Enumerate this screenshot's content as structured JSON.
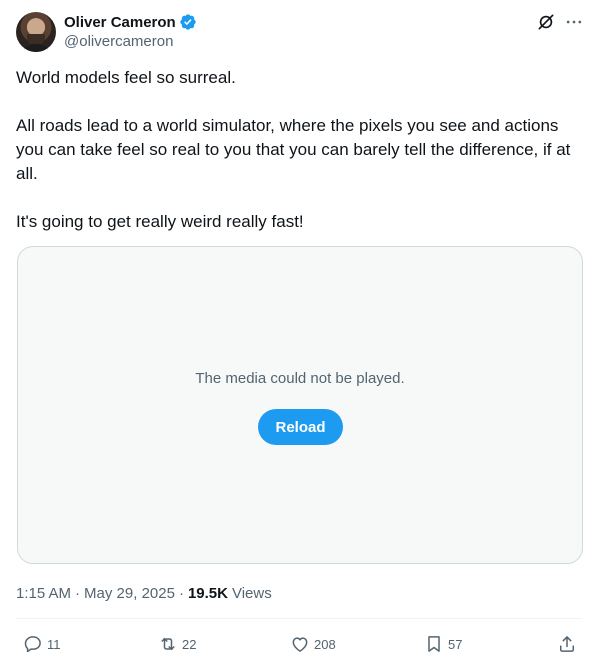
{
  "author": {
    "display_name": "Oliver Cameron",
    "handle": "@olivercameron",
    "verified": true
  },
  "post": {
    "paragraphs": [
      "World models feel so surreal.",
      "All roads lead to a world simulator, where the pixels you see and actions you can take feel so real to you that you can barely tell the difference, if at all.",
      "It's going to get really weird really fast!"
    ]
  },
  "media": {
    "message": "The media could not be played.",
    "reload_label": "Reload"
  },
  "meta": {
    "time": "1:15 AM",
    "separator": "·",
    "date": "May 29, 2025",
    "views_count": "19.5K",
    "views_label": "Views"
  },
  "actions": {
    "replies": "11",
    "reposts": "22",
    "likes": "208",
    "bookmarks": "57"
  },
  "colors": {
    "accent": "#1d9bf0",
    "secondary_text": "#536471",
    "primary_text": "#0f1419"
  },
  "icons": [
    "verified-badge-icon",
    "grok-icon",
    "more-icon",
    "reply-icon",
    "repost-icon",
    "like-icon",
    "bookmark-icon",
    "share-icon"
  ]
}
